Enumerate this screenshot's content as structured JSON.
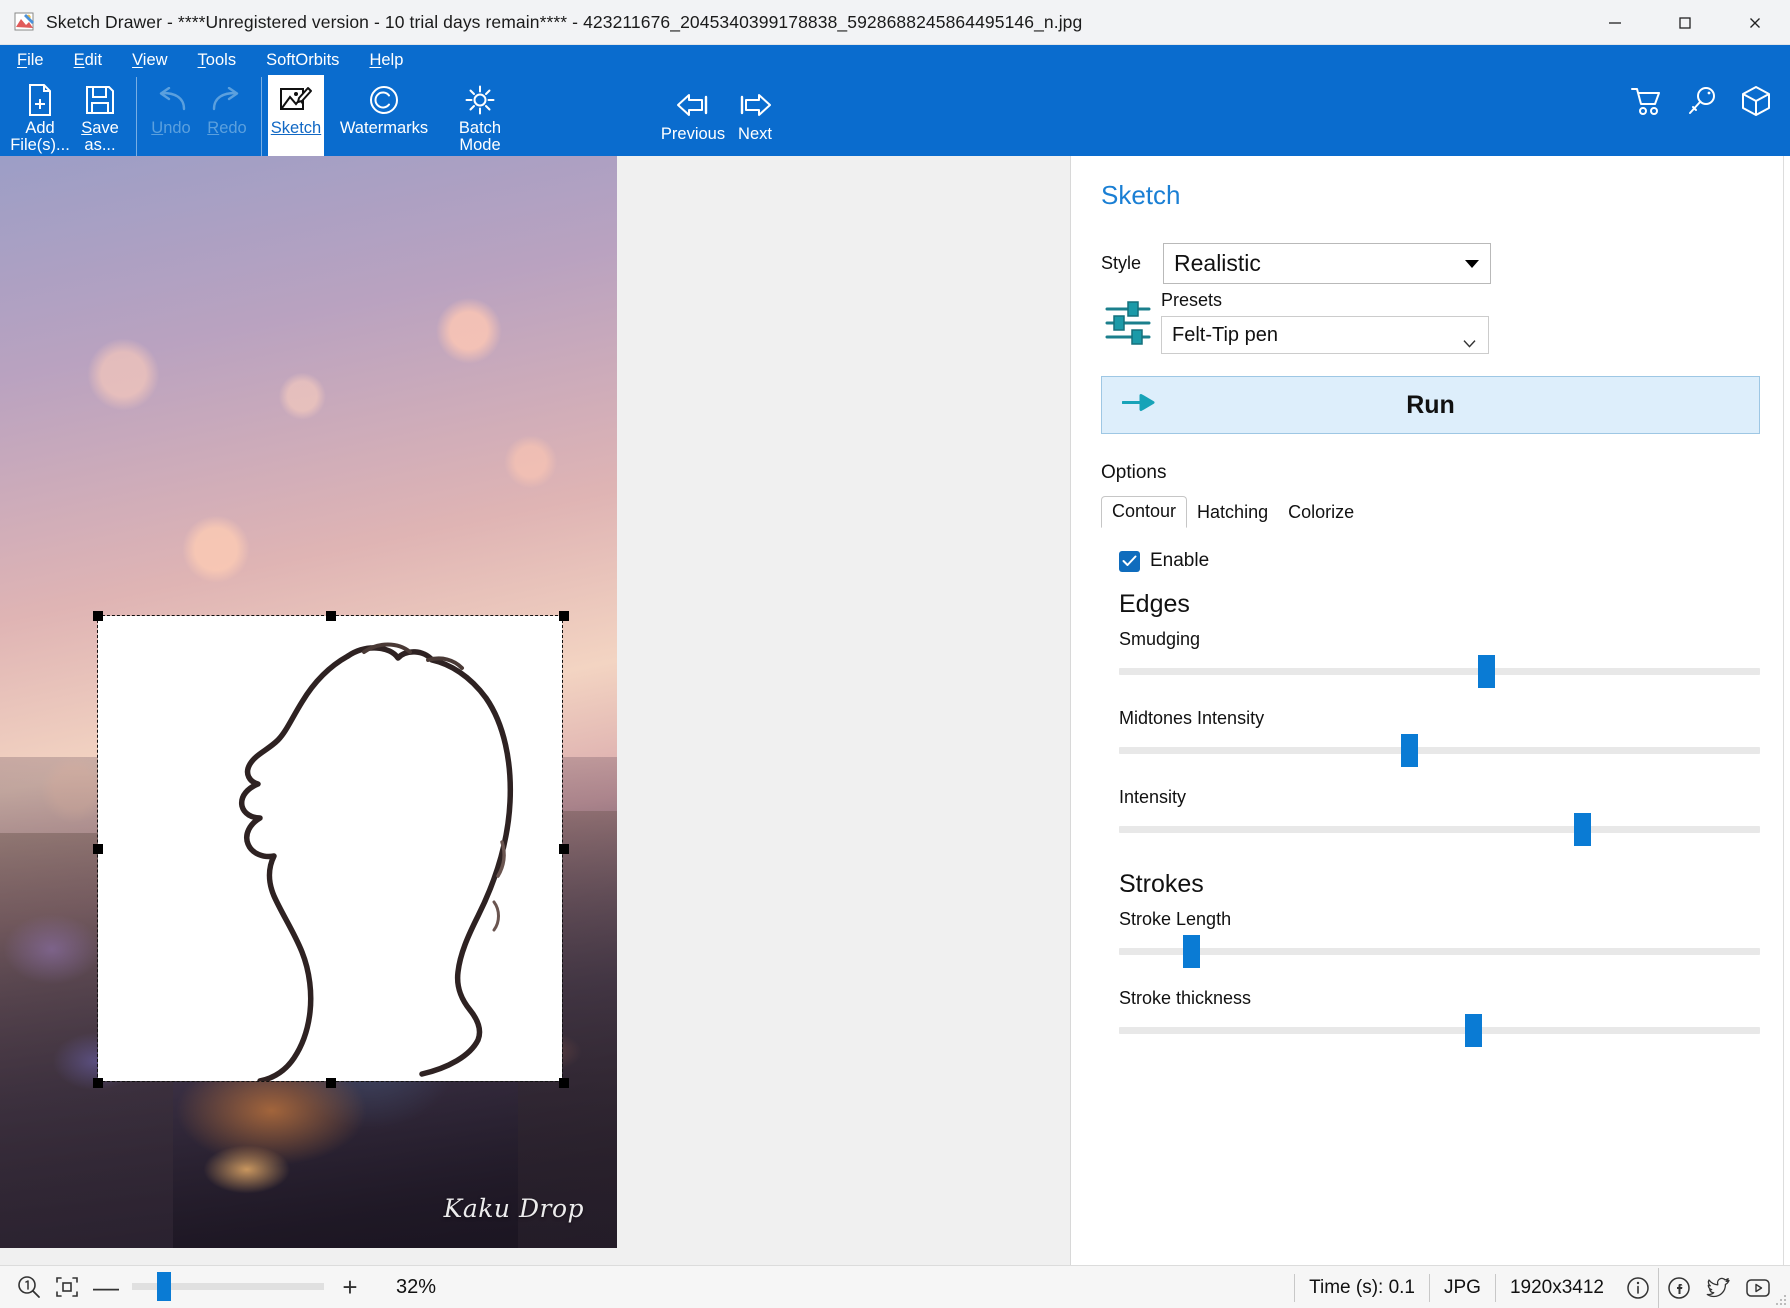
{
  "window": {
    "title": "Sketch Drawer - ****Unregistered version - 10 trial days remain**** - 423211676_2045340399178838_5928688245864495146_n.jpg",
    "app_icon": "sketch-drawer-app-icon",
    "minimize": "—",
    "maximize": "□",
    "close": "✕"
  },
  "menu": {
    "items": [
      {
        "label": "File",
        "accel": "F"
      },
      {
        "label": "Edit",
        "accel": "E"
      },
      {
        "label": "View",
        "accel": "V"
      },
      {
        "label": "Tools",
        "accel": "T"
      },
      {
        "label": "SoftOrbits",
        "accel": ""
      },
      {
        "label": "Help",
        "accel": "H"
      }
    ]
  },
  "toolbar": {
    "buttons": [
      {
        "id": "add-files",
        "line1": "Add",
        "line2": "File(s)...",
        "icon": "add-file-icon",
        "state": "enabled"
      },
      {
        "id": "save-as",
        "line1": "Save",
        "line2": "as...",
        "icon": "save-icon",
        "state": "enabled"
      },
      {
        "id": "undo",
        "line1": "Undo",
        "line2": "",
        "icon": "undo-icon",
        "state": "disabled"
      },
      {
        "id": "redo",
        "line1": "Redo",
        "line2": "",
        "icon": "redo-icon",
        "state": "disabled"
      },
      {
        "id": "sketch",
        "line1": "Sketch",
        "line2": "",
        "icon": "sketch-icon",
        "state": "active"
      },
      {
        "id": "watermarks",
        "line1": "Watermarks",
        "line2": "",
        "icon": "copyright-icon",
        "state": "enabled"
      },
      {
        "id": "batch-mode",
        "line1": "Batch",
        "line2": "Mode",
        "icon": "gear-icon",
        "state": "enabled"
      }
    ],
    "nav": [
      {
        "id": "previous",
        "label": "Previous",
        "icon": "arrow-left-icon"
      },
      {
        "id": "next",
        "label": "Next",
        "icon": "arrow-right-icon"
      }
    ],
    "right_icons": [
      {
        "id": "cart",
        "name": "shopping-cart-icon"
      },
      {
        "id": "key",
        "name": "key-icon"
      },
      {
        "id": "package",
        "name": "box-icon"
      }
    ]
  },
  "canvas": {
    "watermark_text": "Kaku Drop",
    "selection": {
      "visible": true
    }
  },
  "panel": {
    "title": "Sketch",
    "style_label": "Style",
    "style_value": "Realistic",
    "presets_label": "Presets",
    "presets_value": "Felt-Tip pen",
    "run_label": "Run",
    "options_label": "Options",
    "tabs": [
      {
        "label": "Contour",
        "active": true
      },
      {
        "label": "Hatching",
        "active": false
      },
      {
        "label": "Colorize",
        "active": false
      }
    ],
    "enable_label": "Enable",
    "enable_checked": true,
    "sections": [
      {
        "heading": "Edges",
        "sliders": [
          {
            "label": "Smudging",
            "percent": 57
          },
          {
            "label": "Midtones Intensity",
            "percent": 45
          },
          {
            "label": "Intensity",
            "percent": 72
          }
        ]
      },
      {
        "heading": "Strokes",
        "sliders": [
          {
            "label": "Stroke Length",
            "percent": 11
          },
          {
            "label": "Stroke thickness",
            "percent": 55
          }
        ]
      }
    ]
  },
  "statusbar": {
    "zoom_100_icon": "zoom-actual-size-icon",
    "fit_icon": "fit-to-window-icon",
    "zoom_out": "—",
    "zoom_in": "+",
    "zoom_percent": "32%",
    "zoom_slider_percent": 14,
    "time_label": "Time (s): 0.1",
    "format": "JPG",
    "dimensions": "1920x3412",
    "social": [
      {
        "id": "info",
        "name": "info-icon"
      },
      {
        "id": "facebook",
        "name": "facebook-icon"
      },
      {
        "id": "twitter",
        "name": "twitter-icon"
      },
      {
        "id": "youtube",
        "name": "youtube-icon"
      }
    ]
  },
  "colors": {
    "ribbon_blue": "#0a6cce",
    "accent_blue": "#0a7bd4",
    "panel_title_blue": "#1a7fd4",
    "run_bg": "#ddeefb",
    "checkbox_blue": "#0f6cbd"
  }
}
